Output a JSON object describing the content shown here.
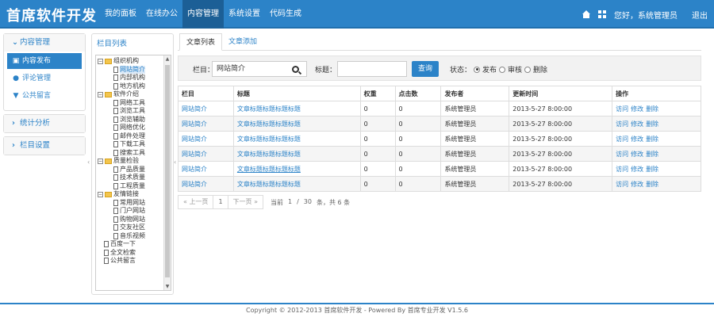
{
  "header": {
    "brand": "首席软件开发",
    "nav": [
      "我的面板",
      "在线办公",
      "内容管理",
      "系统设置",
      "代码生成"
    ],
    "active_nav": 2,
    "greeting": "您好，系统管理员",
    "logout": "退出"
  },
  "sidebar": {
    "groups": [
      {
        "title": "内容管理",
        "expanded": true,
        "items": [
          {
            "label": "内容发布",
            "icon": "briefcase-icon",
            "active": true
          },
          {
            "label": "评论管理",
            "icon": "comment-icon",
            "active": false
          },
          {
            "label": "公共留言",
            "icon": "filter-icon",
            "active": false
          }
        ]
      },
      {
        "title": "统计分析",
        "expanded": false,
        "items": []
      },
      {
        "title": "栏目设置",
        "expanded": false,
        "items": []
      }
    ]
  },
  "tree": {
    "title": "栏目列表",
    "nodes": [
      {
        "label": "组织机构",
        "type": "folder",
        "level": 1
      },
      {
        "label": "网站简介",
        "type": "file",
        "level": 2,
        "selected": true
      },
      {
        "label": "内部机构",
        "type": "file",
        "level": 2
      },
      {
        "label": "地方机构",
        "type": "file",
        "level": 2
      },
      {
        "label": "软件介绍",
        "type": "folder",
        "level": 1
      },
      {
        "label": "网络工具",
        "type": "file",
        "level": 2
      },
      {
        "label": "浏览工具",
        "type": "file",
        "level": 2
      },
      {
        "label": "浏览辅助",
        "type": "file",
        "level": 2
      },
      {
        "label": "网络优化",
        "type": "file",
        "level": 2
      },
      {
        "label": "邮件处理",
        "type": "file",
        "level": 2
      },
      {
        "label": "下载工具",
        "type": "file",
        "level": 2
      },
      {
        "label": "搜索工具",
        "type": "file",
        "level": 2
      },
      {
        "label": "质量检验",
        "type": "folder",
        "level": 1
      },
      {
        "label": "产品质量",
        "type": "file",
        "level": 2
      },
      {
        "label": "技术质量",
        "type": "file",
        "level": 2
      },
      {
        "label": "工程质量",
        "type": "file",
        "level": 2
      },
      {
        "label": "友情链接",
        "type": "folder",
        "level": 1
      },
      {
        "label": "常用网站",
        "type": "file",
        "level": 2
      },
      {
        "label": "门户网站",
        "type": "file",
        "level": 2
      },
      {
        "label": "购物网站",
        "type": "file",
        "level": 2
      },
      {
        "label": "交友社区",
        "type": "file",
        "level": 2
      },
      {
        "label": "音乐视频",
        "type": "file",
        "level": 2
      },
      {
        "label": "百度一下",
        "type": "file",
        "level": 0
      },
      {
        "label": "全文检索",
        "type": "file",
        "level": 0
      },
      {
        "label": "公共留言",
        "type": "file",
        "level": 0
      }
    ]
  },
  "tabs": [
    "文章列表",
    "文章添加"
  ],
  "filter": {
    "column_label": "栏目：",
    "column_value": "网站简介",
    "title_label": "标题：",
    "title_value": "",
    "query_button": "查询",
    "status_label": "状态：",
    "status_options": [
      {
        "label": "发布",
        "checked": true
      },
      {
        "label": "审核",
        "checked": false
      },
      {
        "label": "删除",
        "checked": false
      }
    ]
  },
  "table": {
    "headers": [
      "栏目",
      "标题",
      "权重",
      "点击数",
      "发布者",
      "更新时间",
      "操作"
    ],
    "rows": [
      [
        "网站简介",
        "文章标题标题标题标题",
        "0",
        "0",
        "系统管理员",
        "2013-5-27 8:00:00"
      ],
      [
        "网站简介",
        "文章标题标题标题标题",
        "0",
        "0",
        "系统管理员",
        "2013-5-27 8:00:00"
      ],
      [
        "网站简介",
        "文章标题标题标题标题",
        "0",
        "0",
        "系统管理员",
        "2013-5-27 8:00:00"
      ],
      [
        "网站简介",
        "文章标题标题标题标题",
        "0",
        "0",
        "系统管理员",
        "2013-5-27 8:00:00"
      ],
      [
        "网站简介",
        "文章标题标题标题标题",
        "0",
        "0",
        "系统管理员",
        "2013-5-27 8:00:00"
      ],
      [
        "网站简介",
        "文章标题标题标题标题",
        "0",
        "0",
        "系统管理员",
        "2013-5-27 8:00:00"
      ]
    ],
    "actions": [
      "访问",
      "修改",
      "删除"
    ]
  },
  "pager": {
    "prev": "« 上一页",
    "current": "1",
    "next": "下一页 »",
    "info": [
      "当前",
      "1",
      "/",
      "30",
      "条，共 6 条"
    ]
  },
  "footer": "Copyright © 2012-2013 首席软件开发 - Powered By 首席专业开发 V1.5.6",
  "colors": {
    "primary": "#2c83c8",
    "header_dark": "#1c5f96"
  }
}
